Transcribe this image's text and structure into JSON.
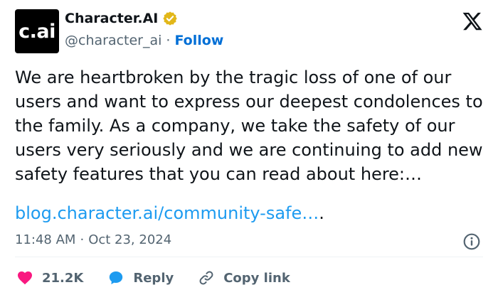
{
  "author": {
    "avatar_text": "c.ai",
    "name": "Character.AI",
    "handle": "@character_ai",
    "separator": "·",
    "follow_label": "Follow"
  },
  "tweet": {
    "text": "We are heartbroken by the tragic loss of one of our users and want to express our deepest condolences to the family. As a company, we take the safety of our users very seriously and we are continuing to add new safety features that you can read about here:…",
    "link": "blog.character.ai/community-safe…",
    "link_suffix": "."
  },
  "meta": {
    "time": "11:48 AM",
    "separator": "·",
    "date": "Oct 23, 2024"
  },
  "actions": {
    "likes": "21.2K",
    "reply_label": "Reply",
    "copy_link_label": "Copy link"
  },
  "colors": {
    "link": "#1d9bf0",
    "follow": "#006fd6",
    "like": "#f91880",
    "reply_icon": "#1d9bf0",
    "verified": "#e2b719"
  },
  "icons": {
    "brand": "x-logo-icon",
    "verified": "verified-badge-icon",
    "info": "info-icon",
    "like": "heart-icon",
    "reply": "reply-bubble-icon",
    "copy_link": "link-icon"
  }
}
